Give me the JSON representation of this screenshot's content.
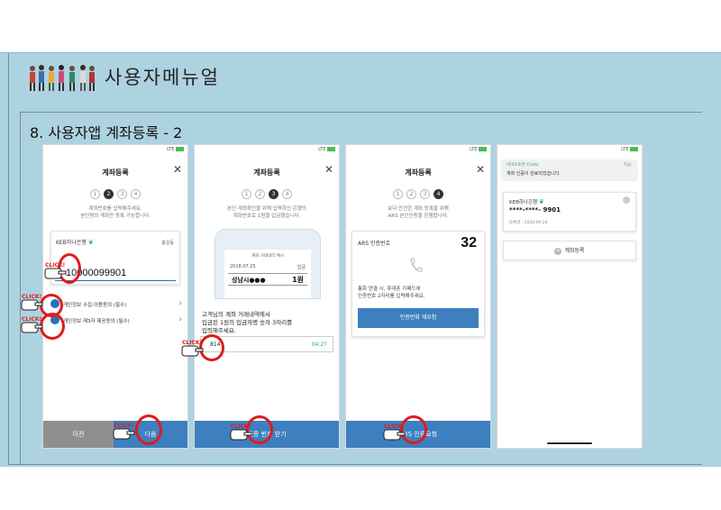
{
  "header": {
    "title": "사용자메뉴얼"
  },
  "section": {
    "title": "8. 사용자앱 계좌등록 - 2"
  },
  "annotation": {
    "click_label": "CLICK!"
  },
  "colors": {
    "slide_bg": "#aed3e0",
    "primary": "#3d7fbf",
    "highlight": "#e01b1b",
    "bank_green": "#1aa37a"
  },
  "phones": {
    "s1": {
      "status": "LTE",
      "title": "계좌등록",
      "steps": [
        "1",
        "2",
        "3",
        "4"
      ],
      "active_step": 2,
      "desc1": "계좌번호를 입력해주세요.",
      "desc2": "본인명의 계좌만 등록 가능합니다.",
      "bank": "KEB하나은행",
      "holder": "홍길동",
      "account": "10000099901",
      "agree1": "개인정보 수집·이용동의 (필수)",
      "agree2": "개인정보 제3자 제공동의 (필수)",
      "prev": "이전",
      "next": "다음"
    },
    "s2": {
      "status": "LTE",
      "title": "계좌등록",
      "steps": [
        "1",
        "2",
        "3",
        "4"
      ],
      "active_step": 3,
      "desc1": "본인 계좌확인을 위해 입력하신 은행의",
      "desc2": "계좌번호로 1원을 입금했습니다.",
      "mock_head": "계좌 거래내역 예시",
      "mock_date": "2018.07.25",
      "mock_label": "입금",
      "mock_name": "성남시●●●",
      "mock_amount": "1원",
      "text1": "고객님의 계좌 거래내역에서",
      "text2": "입금된 1원의 입금자명 숫자 3자리를",
      "text3": "입력해주세요.",
      "code": "814",
      "timer": "04:27",
      "button": "인증 번호 받기"
    },
    "s3": {
      "status": "LTE",
      "title": "계좌등록",
      "steps": [
        "1",
        "2",
        "3",
        "4"
      ],
      "active_step": 4,
      "desc1": "보다 안전한 계좌 등록을 위해",
      "desc2": "ARS 본인인증을 진행합니다.",
      "ars_label": "ARS 인증번호",
      "ars_code": "32",
      "ars_text1": "통화 연결 시, 휴대폰 키패드에",
      "ars_text2": "인증번호 2자리를 입력해주세요.",
      "ars_btn": "인증번화 재요청",
      "button": "ARS 인증요청"
    },
    "s4": {
      "status": "LTE",
      "notif_app": "미미오토콘 Chatx",
      "notif_time": "지금",
      "notif_msg": "계좌 인증이 완료되었습니다.",
      "bank": "KEB하나은행",
      "account": "****-****- 9901",
      "date": "등록일 : 2020.09.24",
      "add": "계좌등록"
    }
  }
}
